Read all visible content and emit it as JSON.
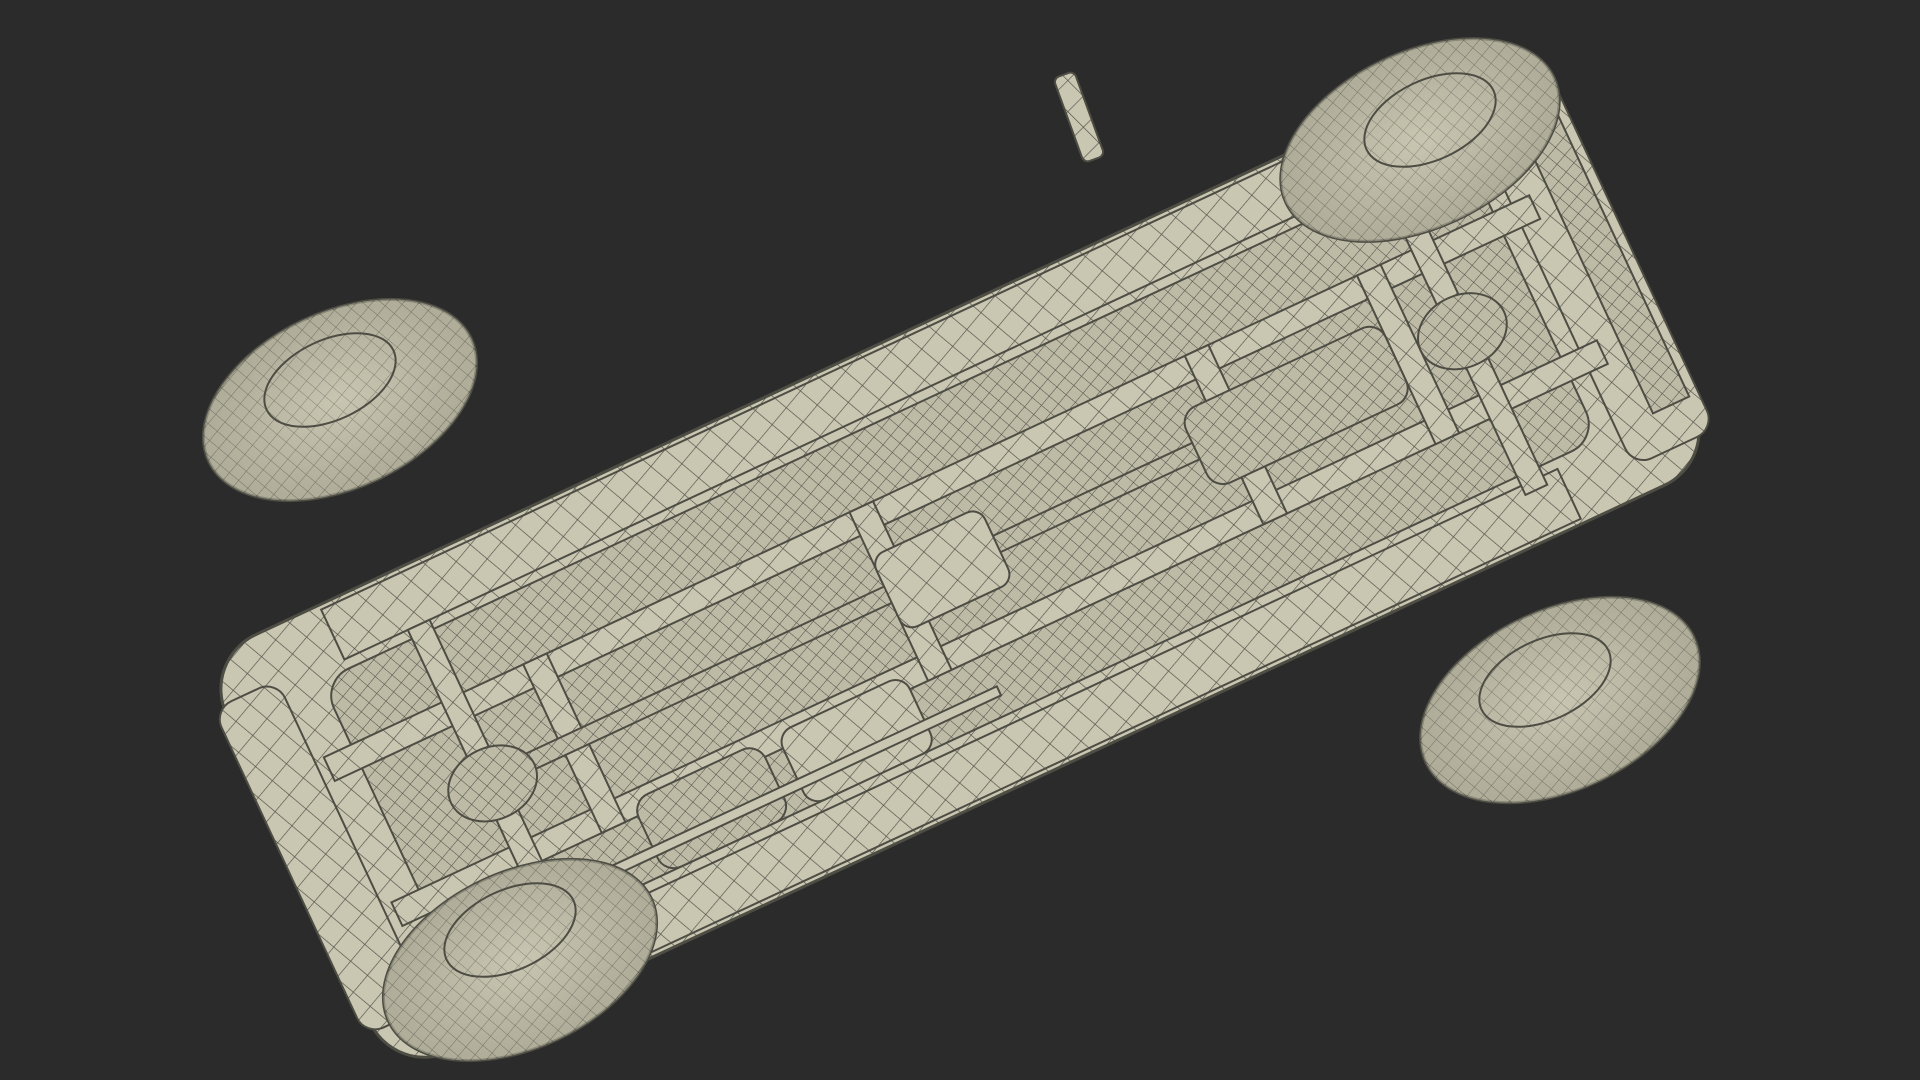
{
  "scene": {
    "background_color": "#2b2b2b",
    "model_color": "#c9c7b2",
    "shadow_color": "#8e8c7a",
    "wire_color": "#4d4d44",
    "subject": "wireframe-car-underside"
  }
}
